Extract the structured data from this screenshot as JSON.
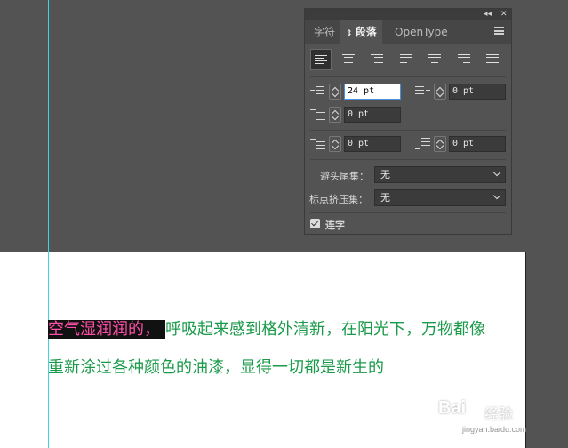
{
  "panel": {
    "tabs": [
      {
        "label": "字符",
        "active": false
      },
      {
        "label": "段落",
        "active": true
      },
      {
        "label": "OpenType",
        "active": false
      }
    ],
    "collapse_glyph": "◂◂",
    "close_glyph": "✕",
    "alignment_buttons": [
      "align-left",
      "align-center",
      "align-right",
      "justify-last-left",
      "justify-last-center",
      "justify-last-right",
      "justify-all"
    ],
    "active_alignment": "align-left",
    "left_indent": "24 pt",
    "right_indent": "0 pt",
    "first_line_indent": "0 pt",
    "space_before": "0 pt",
    "space_after": "0 pt",
    "kinsoku_label": "避头尾集：",
    "kinsoku_value": "无",
    "mojikumi_label": "标点挤压集：",
    "mojikumi_value": "无",
    "hyphenate_label": "连字",
    "hyphenate_checked": true
  },
  "document": {
    "line1_selected": "空气湿润润的，",
    "line1_rest": "呼吸起来感到格外清新，在阳光下，万物都像",
    "line2": "重新涂过各种颜色的油漆，显得一切都是新生的",
    "text_color": "#1a9a4a",
    "selection_text_color": "#ff4fa8"
  },
  "watermark": {
    "brand": "Bai",
    "brand_suffix": "经验",
    "url": "jingyan.baidu.com"
  }
}
